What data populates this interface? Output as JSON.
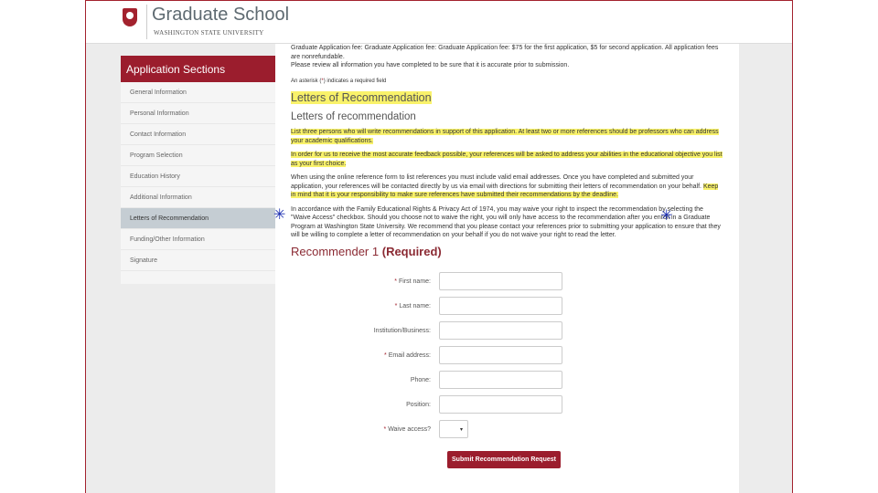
{
  "header": {
    "title": "Graduate School",
    "subtitle": "WASHINGTON STATE UNIVERSITY"
  },
  "sidebar": {
    "title": "Application Sections",
    "items": [
      {
        "label": "General Information"
      },
      {
        "label": "Personal Information"
      },
      {
        "label": "Contact Information"
      },
      {
        "label": "Program Selection"
      },
      {
        "label": "Education History"
      },
      {
        "label": "Additional Information"
      },
      {
        "label": "Letters of Recommendation",
        "active": true
      },
      {
        "label": "Funding/Other Information"
      },
      {
        "label": "Signature"
      }
    ]
  },
  "main": {
    "fee_text": "Graduate Application fee: Graduate Application fee: Graduate Application fee: $75 for the first application, $5 for second application. All application fees are nonrefundable.",
    "review_text": "Please review all information you have completed to be sure that it is accurate prior to submission.",
    "asterisk_pre": "An asterisk (",
    "asterisk_mark": "*",
    "asterisk_post": ") indicates a required field",
    "section_title": "Letters of Recommendation",
    "subsection_title": "Letters of recommendation",
    "para1": "List three persons who will write recommendations in support of this application. At least two or more references should be professors who can address your academic qualifications.",
    "para2": "In order for us to receive the most accurate feedback possible, your references will be asked to address your abilities in the educational objective you list as your first choice.",
    "para3": "When using the online reference form to list references you must include valid email addresses. Once you have completed and submitted your application, your references will be contacted directly by us via email with directions for submitting their letters of recommendation on your behalf.",
    "para3_highlight": "Keep in mind that it is your responsibility to make sure references have submitted their recommendations by the deadline.",
    "para4": "In accordance with the Family Educational Rights & Privacy Act of 1974, you may waive your right to inspect the recommendation by selecting the \"Waive Access\" checkbox. Should you choose not to waive the right, you will only have access to the recommendation after you enroll in a Graduate Program at Washington State University. We recommend that you please contact your references prior to submitting your application to ensure that they will be willing to complete a letter of recommendation on your behalf if you do not waive your right to read the letter.",
    "recommender_title": "Recommender 1",
    "recommender_required": "(Required)",
    "fields": [
      {
        "label": "First name:",
        "required": true,
        "value": ""
      },
      {
        "label": "Last name:",
        "required": true,
        "value": ""
      },
      {
        "label": "Institution/Business:",
        "required": false,
        "value": ""
      },
      {
        "label": "Email address:",
        "required": true,
        "value": ""
      },
      {
        "label": "Phone:",
        "required": false,
        "value": ""
      },
      {
        "label": "Position:",
        "required": false,
        "value": ""
      }
    ],
    "waive": {
      "label": "Waive access?",
      "required": true,
      "value": "",
      "arrow": "▾"
    },
    "submit_label": "Submit Recommendation Request",
    "required_mark": "*"
  },
  "annotations": {
    "star": "✳"
  },
  "colors": {
    "brand": "#9b1d2d",
    "highlight": "#f9f26a",
    "annotation": "#1a2db0"
  }
}
